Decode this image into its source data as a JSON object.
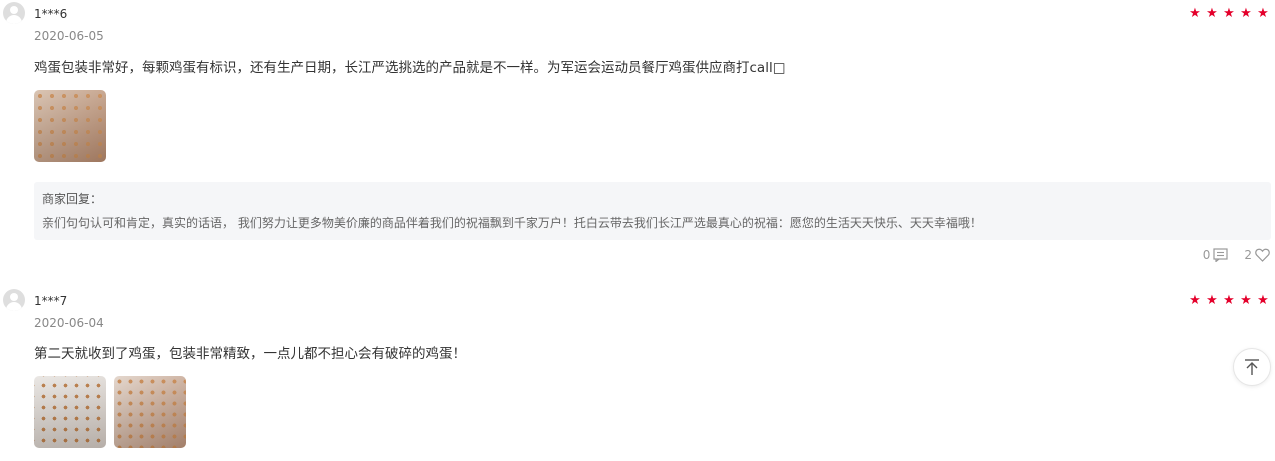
{
  "reviews": [
    {
      "username": "1***6",
      "date": "2020-06-05",
      "rating": 5,
      "star_color": "#e4002b",
      "content": "鸡蛋包装非常好，每颗鸡蛋有标识，还有生产日期，长江严选挑选的产品就是不一样。为军运会运动员餐厅鸡蛋供应商打call□",
      "image_count": 1,
      "reply": {
        "label": "商家回复：",
        "text": "亲们句句认可和肯定，真实的话语， 我们努力让更多物美价廉的商品伴着我们的祝福飘到千家万户！托白云带去我们长江严选最真心的祝福：愿您的生活天天快乐、天天幸福哦！"
      },
      "comment_count": "0",
      "like_count": "2"
    },
    {
      "username": "1***7",
      "date": "2020-06-04",
      "rating": 5,
      "star_color": "#e4002b",
      "content": "第二天就收到了鸡蛋，包装非常精致，一点儿都不担心会有破碎的鸡蛋！",
      "image_count": 2
    }
  ],
  "icons": {
    "avatar": "user-avatar-icon",
    "star": "star-icon",
    "comment": "comment-icon",
    "like": "heart-icon",
    "back_to_top": "arrow-up-to-top-icon"
  }
}
